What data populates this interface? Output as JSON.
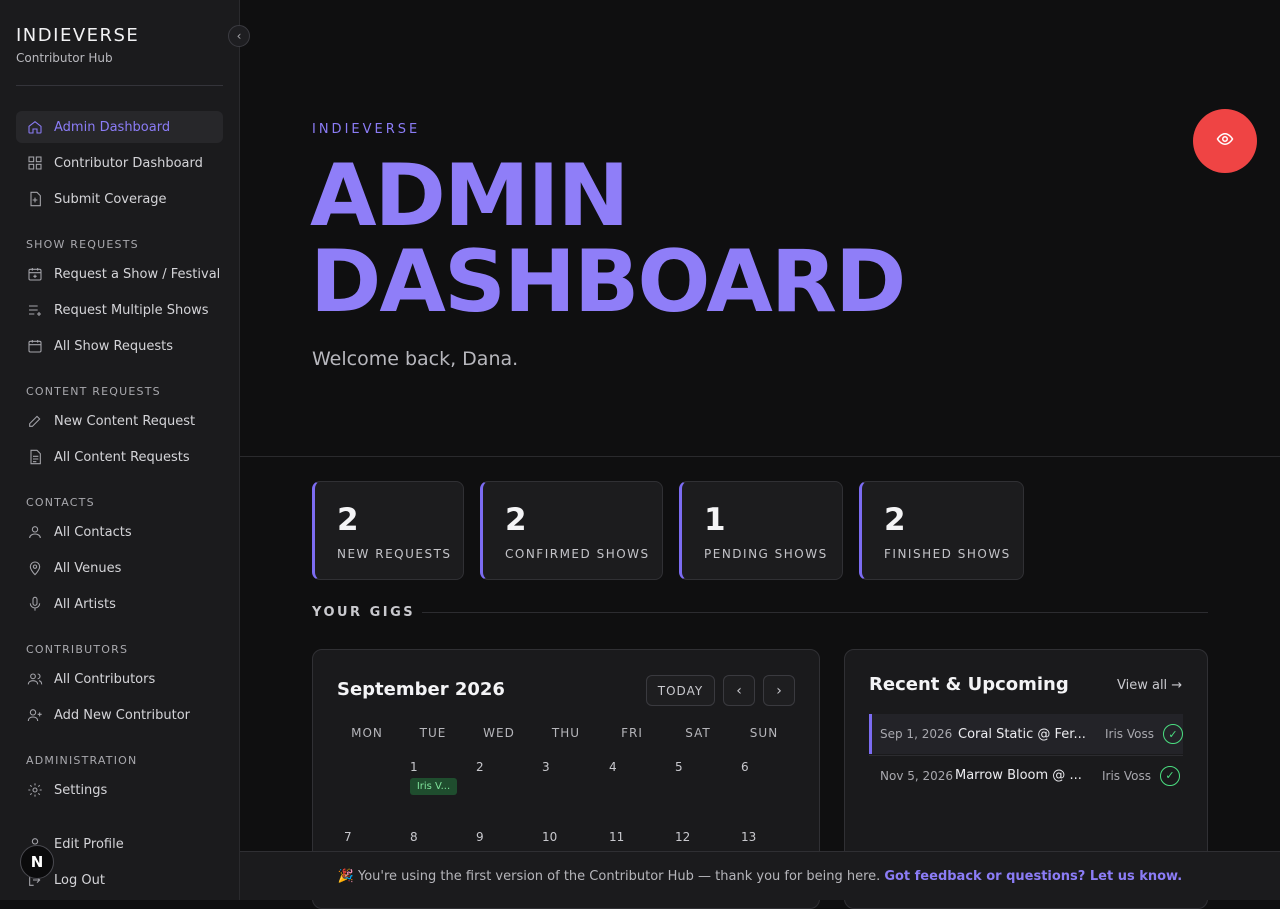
{
  "brand": {
    "title": "INDIEVERSE",
    "subtitle": "Contributor Hub"
  },
  "sidebar": {
    "top": [
      {
        "label": "Admin Dashboard",
        "icon": "home-icon",
        "active": true
      },
      {
        "label": "Contributor Dashboard",
        "icon": "grid-icon"
      },
      {
        "label": "Submit Coverage",
        "icon": "file-plus-icon"
      }
    ],
    "sections": [
      {
        "title": "SHOW REQUESTS",
        "items": [
          {
            "label": "Request a Show / Festival",
            "icon": "calendar-plus-icon"
          },
          {
            "label": "Request Multiple Shows",
            "icon": "list-plus-icon"
          },
          {
            "label": "All Show Requests",
            "icon": "calendar-icon"
          }
        ]
      },
      {
        "title": "CONTENT REQUESTS",
        "items": [
          {
            "label": "New Content Request",
            "icon": "pencil-icon"
          },
          {
            "label": "All Content Requests",
            "icon": "document-icon"
          }
        ]
      },
      {
        "title": "CONTACTS",
        "items": [
          {
            "label": "All Contacts",
            "icon": "user-icon"
          },
          {
            "label": "All Venues",
            "icon": "map-pin-icon"
          },
          {
            "label": "All Artists",
            "icon": "microphone-icon"
          }
        ]
      },
      {
        "title": "CONTRIBUTORS",
        "items": [
          {
            "label": "All Contributors",
            "icon": "users-icon"
          },
          {
            "label": "Add New Contributor",
            "icon": "user-plus-icon"
          }
        ]
      },
      {
        "title": "ADMINISTRATION",
        "items": [
          {
            "label": "Settings",
            "icon": "gear-icon"
          }
        ]
      }
    ],
    "bottom": [
      {
        "label": "Edit Profile",
        "icon": "user-icon"
      },
      {
        "label": "Log Out",
        "icon": "logout-icon"
      }
    ],
    "badge": "N"
  },
  "header": {
    "eyebrow": "INDIEVERSE",
    "title_line1": "ADMIN",
    "title_line2": "DASHBOARD",
    "welcome": "Welcome back, Dana."
  },
  "stats": [
    {
      "value": "2",
      "label": "NEW REQUESTS"
    },
    {
      "value": "2",
      "label": "CONFIRMED SHOWS"
    },
    {
      "value": "1",
      "label": "PENDING SHOWS"
    },
    {
      "value": "2",
      "label": "FINISHED SHOWS"
    }
  ],
  "gigs": {
    "title": "YOUR GIGS",
    "calendar": {
      "month": "September 2026",
      "today_label": "TODAY",
      "prev": "‹",
      "next": "›",
      "weekdays": [
        "MON",
        "TUE",
        "WED",
        "THU",
        "FRI",
        "SAT",
        "SUN"
      ],
      "week1": [
        "1",
        "2",
        "3",
        "4",
        "5",
        "6"
      ],
      "week2": [
        "7",
        "8",
        "9",
        "10",
        "11",
        "12",
        "13"
      ],
      "event_chip": "Iris V..."
    },
    "recent": {
      "title": "Recent & Upcoming",
      "view_all": "View all →",
      "rows": [
        {
          "date": "Sep 1, 2026",
          "title": "Coral Static @ Fer...",
          "who": "Iris Voss",
          "status": "✓"
        },
        {
          "date": "Nov 5, 2026",
          "title": "Marrow Bloom @ ...",
          "who": "Iris Voss",
          "status": "✓"
        }
      ]
    }
  },
  "footer": {
    "emoji": "🎉",
    "text": "You're using the first version of the Contributor Hub — thank you for being here.",
    "link": "Got feedback or questions? Let us know."
  },
  "colors": {
    "accent": "#8b7cf6",
    "danger": "#ef4444",
    "success": "#4ade80"
  }
}
